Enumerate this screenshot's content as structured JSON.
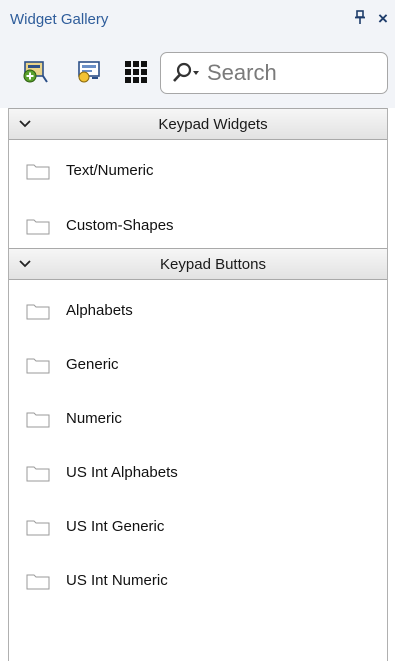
{
  "panel": {
    "title": "Widget Gallery",
    "pin_glyph": "ᴩ",
    "close_glyph": "×"
  },
  "toolbar": {
    "buttons": [
      {
        "icon": "add-widget-icon"
      },
      {
        "icon": "edit-widget-icon"
      },
      {
        "icon": "grid-view-icon"
      }
    ],
    "search": {
      "placeholder": "Search",
      "value": ""
    }
  },
  "groups": [
    {
      "label": "Keypad Widgets",
      "expanded": true,
      "items": [
        {
          "label": "Text/Numeric",
          "icon": "folder-icon"
        },
        {
          "label": "Custom-Shapes",
          "icon": "folder-icon"
        }
      ]
    },
    {
      "label": "Keypad Buttons",
      "expanded": true,
      "items": [
        {
          "label": "Alphabets",
          "icon": "folder-icon"
        },
        {
          "label": "Generic",
          "icon": "folder-icon"
        },
        {
          "label": "Numeric",
          "icon": "folder-icon"
        },
        {
          "label": "US Int Alphabets",
          "icon": "folder-icon"
        },
        {
          "label": "US Int Generic",
          "icon": "folder-icon"
        },
        {
          "label": "US Int Numeric",
          "icon": "folder-icon"
        }
      ]
    }
  ],
  "colors": {
    "title_text": "#2f5d9b",
    "chrome_background": "#f2f4f8",
    "header_gradient_top": "#f6f6f6",
    "header_gradient_bottom": "#e2e2e2"
  }
}
